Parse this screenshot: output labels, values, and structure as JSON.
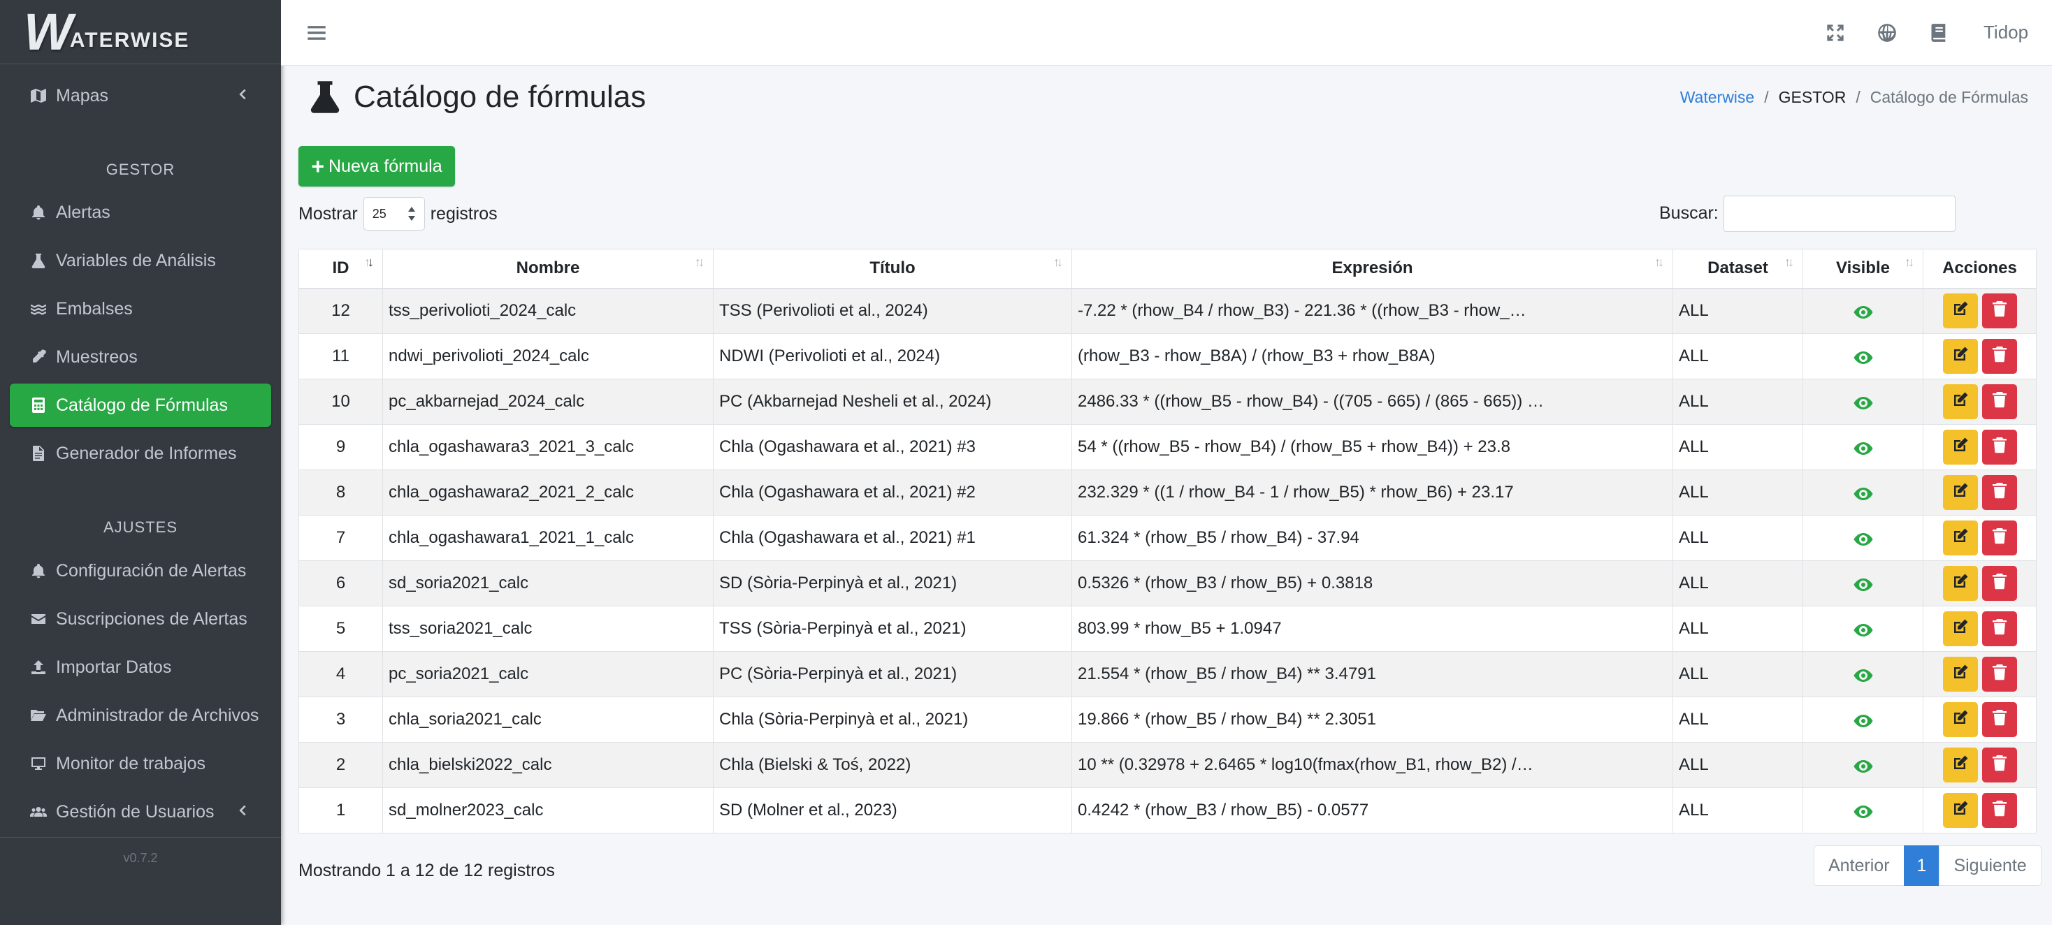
{
  "brand": {
    "logo_letter": "W",
    "name": "ATERWISE"
  },
  "sidebar": {
    "maps": "Mapas",
    "section_gestor": "GESTOR",
    "gestor_items": [
      {
        "label": "Alertas",
        "icon": "bell-icon"
      },
      {
        "label": "Variables de Análisis",
        "icon": "flask-icon"
      },
      {
        "label": "Embalses",
        "icon": "water-icon"
      },
      {
        "label": "Muestreos",
        "icon": "eyedropper-icon"
      },
      {
        "label": "Catálogo de Fórmulas",
        "icon": "calculator-icon"
      },
      {
        "label": "Generador de Informes",
        "icon": "file-icon"
      }
    ],
    "section_ajustes": "AJUSTES",
    "ajustes_items": [
      {
        "label": "Configuración de Alertas",
        "icon": "bell-icon"
      },
      {
        "label": "Suscripciones de Alertas",
        "icon": "envelope-icon"
      },
      {
        "label": "Importar Datos",
        "icon": "upload-icon"
      },
      {
        "label": "Administrador de Archivos",
        "icon": "folder-open-icon"
      },
      {
        "label": "Monitor de trabajos",
        "icon": "desktop-icon"
      },
      {
        "label": "Gestión de Usuarios",
        "icon": "users-icon"
      }
    ],
    "version": "v0.7.2"
  },
  "topbar": {
    "user": "Tidop"
  },
  "header": {
    "title": "Catálogo de fórmulas",
    "breadcrumb": [
      "Waterwise",
      "GESTOR",
      "Catálogo de Fórmulas"
    ]
  },
  "controls": {
    "new_button": "Nueva fórmula",
    "show_label": "Mostrar",
    "page_size": "25",
    "records_label": "registros",
    "search_label": "Buscar:",
    "search_value": ""
  },
  "table": {
    "columns": [
      "ID",
      "Nombre",
      "Título",
      "Expresión",
      "Dataset",
      "Visible",
      "Acciones"
    ],
    "rows": [
      {
        "id": "12",
        "nombre": "tss_perivolioti_2024_calc",
        "titulo": "TSS (Perivolioti et al., 2024)",
        "expresion": "-7.22 * (rhow_B4 / rhow_B3) - 221.36 * ((rhow_B3 - rhow_…",
        "dataset": "ALL"
      },
      {
        "id": "11",
        "nombre": "ndwi_perivolioti_2024_calc",
        "titulo": "NDWI (Perivolioti et al., 2024)",
        "expresion": "(rhow_B3 - rhow_B8A) / (rhow_B3 + rhow_B8A)",
        "dataset": "ALL"
      },
      {
        "id": "10",
        "nombre": "pc_akbarnejad_2024_calc",
        "titulo": "PC (Akbarnejad Nesheli et al., 2024)",
        "expresion": "2486.33 * ((rhow_B5 - rhow_B4) - ((705 - 665) / (865 - 665)) …",
        "dataset": "ALL"
      },
      {
        "id": "9",
        "nombre": "chla_ogashawara3_2021_3_calc",
        "titulo": "Chla (Ogashawara et al., 2021) #3",
        "expresion": "54 * ((rhow_B5 - rhow_B4) / (rhow_B5 + rhow_B4)) + 23.8",
        "dataset": "ALL"
      },
      {
        "id": "8",
        "nombre": "chla_ogashawara2_2021_2_calc",
        "titulo": "Chla (Ogashawara et al., 2021) #2",
        "expresion": "232.329 * ((1 / rhow_B4 - 1 / rhow_B5) * rhow_B6) + 23.17",
        "dataset": "ALL"
      },
      {
        "id": "7",
        "nombre": "chla_ogashawara1_2021_1_calc",
        "titulo": "Chla (Ogashawara et al., 2021) #1",
        "expresion": "61.324 * (rhow_B5 / rhow_B4) - 37.94",
        "dataset": "ALL"
      },
      {
        "id": "6",
        "nombre": "sd_soria2021_calc",
        "titulo": "SD (Sòria-Perpinyà et al., 2021)",
        "expresion": "0.5326 * (rhow_B3 / rhow_B5) + 0.3818",
        "dataset": "ALL"
      },
      {
        "id": "5",
        "nombre": "tss_soria2021_calc",
        "titulo": "TSS (Sòria-Perpinyà et al., 2021)",
        "expresion": "803.99 * rhow_B5 + 1.0947",
        "dataset": "ALL"
      },
      {
        "id": "4",
        "nombre": "pc_soria2021_calc",
        "titulo": "PC (Sòria-Perpinyà et al., 2021)",
        "expresion": "21.554 * (rhow_B5 / rhow_B4) ** 3.4791",
        "dataset": "ALL"
      },
      {
        "id": "3",
        "nombre": "chla_soria2021_calc",
        "titulo": "Chla (Sòria-Perpinyà et al., 2021)",
        "expresion": "19.866 * (rhow_B5 / rhow_B4) ** 2.3051",
        "dataset": "ALL"
      },
      {
        "id": "2",
        "nombre": "chla_bielski2022_calc",
        "titulo": "Chla (Bielski & Toś, 2022)",
        "expresion": "10 ** (0.32978 + 2.6465 * log10(fmax(rhow_B1, rhow_B2) /…",
        "dataset": "ALL"
      },
      {
        "id": "1",
        "nombre": "sd_molner2023_calc",
        "titulo": "SD (Molner et al., 2023)",
        "expresion": "0.4242 * (rhow_B3 / rhow_B5) - 0.0577",
        "dataset": "ALL"
      }
    ]
  },
  "footer": {
    "info": "Mostrando 1 a 12 de 12 registros",
    "prev": "Anterior",
    "page": "1",
    "next": "Siguiente"
  },
  "colors": {
    "accent_green": "#28a745",
    "sidebar_bg": "#343a40",
    "link_blue": "#2f7ed8",
    "edit_yellow": "#f4c12a",
    "delete_red": "#dc3545"
  }
}
